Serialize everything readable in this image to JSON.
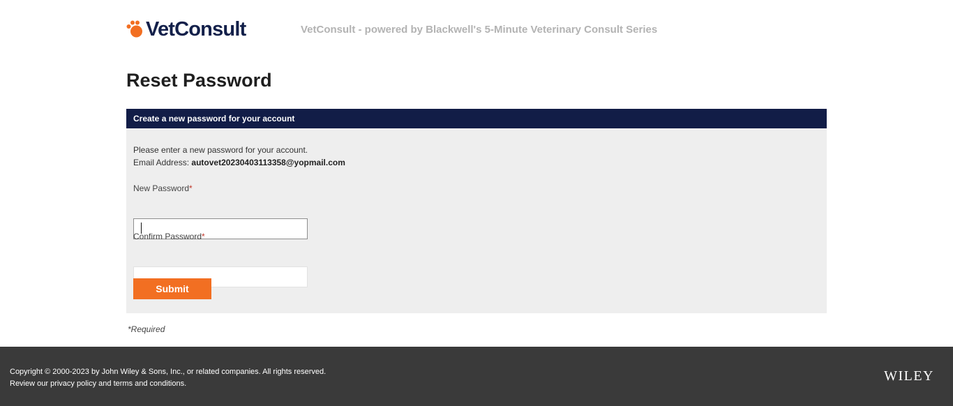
{
  "header": {
    "logo_text": "VetConsult",
    "tagline": "VetConsult - powered by Blackwell's 5-Minute Veterinary Consult Series",
    "logo_color": "#13204a",
    "paw_color": "#f26f22"
  },
  "page": {
    "title": "Reset Password"
  },
  "panel": {
    "header": "Create a new password for your account",
    "instructions": "Please enter a new password for your account.",
    "email_label": "Email Address:",
    "email_value": "autovet20230403113358@yopmail.com"
  },
  "form": {
    "new_password_label": "New Password",
    "new_password_value": "",
    "confirm_password_label": "Confirm Password",
    "confirm_password_value": "",
    "required_marker": "*",
    "submit_label": "Submit",
    "submit_color": "#f26f22",
    "required_note": "*Required"
  },
  "footer": {
    "copyright": "Copyright © 2000-2023 by John Wiley & Sons, Inc., or related companies. All rights reserved.",
    "review_prefix": "Review our ",
    "privacy_link": "privacy policy",
    "and_text": " and ",
    "terms_link": "terms and conditions",
    "suffix": ".",
    "brand": "WILEY"
  }
}
